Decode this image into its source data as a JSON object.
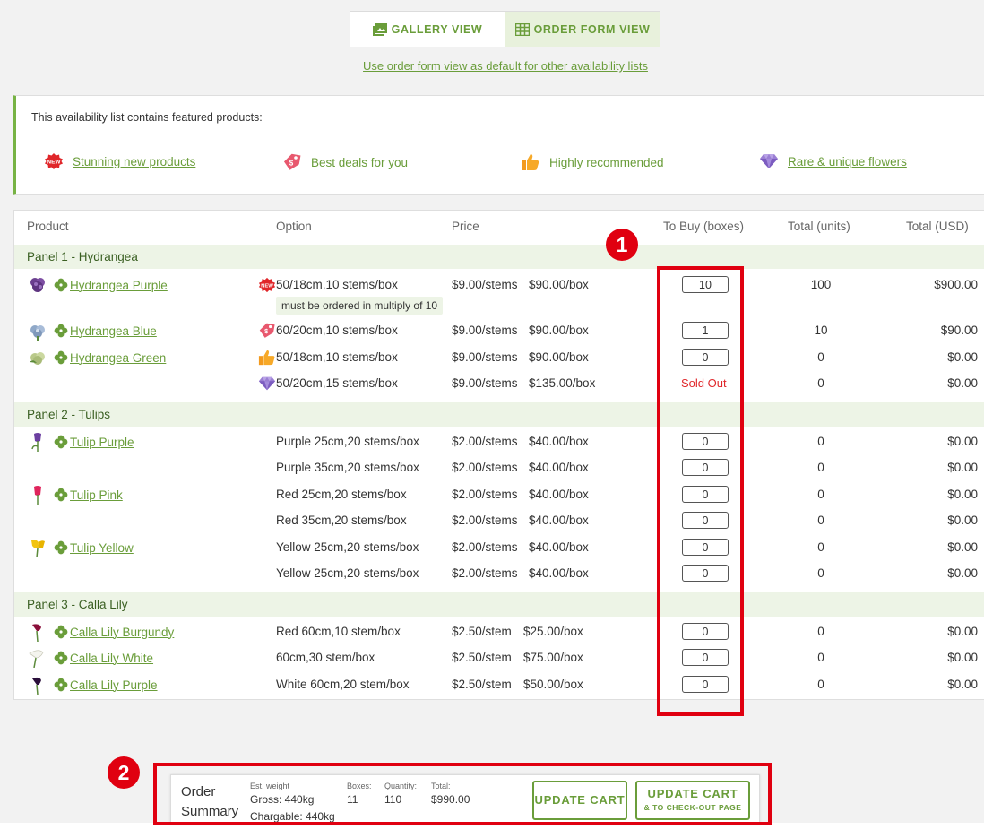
{
  "view_toggle": {
    "gallery_label": "GALLERY VIEW",
    "order_form_label": "ORDER FORM VIEW",
    "active": "order_form"
  },
  "default_link": "Use order form view as default for other availability lists",
  "featured": {
    "intro": "This availability list contains featured products:",
    "items": [
      {
        "icon": "new-badge-icon",
        "label": "Stunning new products"
      },
      {
        "icon": "price-tag-icon",
        "label": "Best deals for you"
      },
      {
        "icon": "thumbs-up-icon",
        "label": "Highly recommended"
      },
      {
        "icon": "diamond-icon",
        "label": "Rare & unique flowers"
      }
    ]
  },
  "table": {
    "headers": {
      "product": "Product",
      "option": "Option",
      "price": "Price",
      "to_buy": "To Buy (boxes)",
      "total_units": "Total (units)",
      "total_usd": "Total (USD)"
    },
    "panels": [
      {
        "label": "Panel 1 - Hydrangea"
      },
      {
        "label": "Panel 2 - Tulips"
      },
      {
        "label": "Panel 3 - Calla Lily"
      }
    ],
    "rows": [
      {
        "product": "Hydrangea Purple",
        "thumb": "hydrangea-purple",
        "badge": "new-badge-icon",
        "option": "50/18cm,10 stems/box",
        "price": "$9.00/stems",
        "box_price": "$90.00/box",
        "qty": "10",
        "units": "100",
        "usd": "$900.00"
      },
      {
        "product": "Hydrangea Blue",
        "thumb": "hydrangea-blue",
        "badge": "price-tag-icon",
        "option": "60/20cm,10 stems/box",
        "price": "$9.00/stems",
        "box_price": "$90.00/box",
        "qty": "1",
        "units": "10",
        "usd": "$90.00"
      },
      {
        "product": "Hydrangea Green",
        "thumb": "hydrangea-green",
        "badge": "thumbs-up-icon",
        "option": "50/18cm,10 stems/box",
        "price": "$9.00/stems",
        "box_price": "$90.00/box",
        "qty": "0",
        "units": "0",
        "usd": "$0.00"
      },
      {
        "product": "",
        "thumb": "",
        "badge": "diamond-icon",
        "option": "50/20cm,15 stems/box",
        "price": "$9.00/stems",
        "box_price": "$135.00/box",
        "status": "Sold Out",
        "units": "0",
        "usd": "$0.00"
      },
      {
        "product": "Tulip Purple",
        "thumb": "tulip-purple",
        "option": "Purple 25cm,20 stems/box",
        "price": "$2.00/stems",
        "box_price": "$40.00/box",
        "qty": "0",
        "units": "0",
        "usd": "$0.00"
      },
      {
        "product": "",
        "option": "Purple 35cm,20 stems/box",
        "price": "$2.00/stems",
        "box_price": "$40.00/box",
        "qty": "0",
        "units": "0",
        "usd": "$0.00"
      },
      {
        "product": "Tulip Pink",
        "thumb": "tulip-pink",
        "option": "Red 25cm,20 stems/box",
        "price": "$2.00/stems",
        "box_price": "$40.00/box",
        "qty": "0",
        "units": "0",
        "usd": "$0.00"
      },
      {
        "product": "",
        "option": "Red 35cm,20 stems/box",
        "price": "$2.00/stems",
        "box_price": "$40.00/box",
        "qty": "0",
        "units": "0",
        "usd": "$0.00"
      },
      {
        "product": "Tulip Yellow",
        "thumb": "tulip-yellow",
        "option": "Yellow 25cm,20 stems/box",
        "price": "$2.00/stems",
        "box_price": "$40.00/box",
        "qty": "0",
        "units": "0",
        "usd": "$0.00"
      },
      {
        "product": "",
        "option": "Yellow 25cm,20 stems/box",
        "price": "$2.00/stems",
        "box_price": "$40.00/box",
        "qty": "0",
        "units": "0",
        "usd": "$0.00"
      },
      {
        "product": "Calla Lily Burgundy",
        "thumb": "calla-burgundy",
        "option": "Red 60cm,10 stem/box",
        "price": "$2.50/stem",
        "box_price": "$25.00/box",
        "qty": "0",
        "units": "0",
        "usd": "$0.00"
      },
      {
        "product": "Calla Lily White",
        "thumb": "calla-white",
        "option": "60cm,30 stem/box",
        "price": "$2.50/stem",
        "box_price": "$75.00/box",
        "qty": "0",
        "units": "0",
        "usd": "$0.00"
      },
      {
        "product": "Calla Lily Purple",
        "thumb": "calla-purple",
        "option": "White 60cm,20 stem/box",
        "price": "$2.50/stem",
        "box_price": "$50.00/box",
        "qty": "0",
        "units": "0",
        "usd": "$0.00"
      }
    ],
    "tooltip": "must be ordered in multiply of 10"
  },
  "annotations": {
    "marker_1": "1",
    "marker_2": "2",
    "color": "#e00010"
  },
  "order_summary": {
    "title_line1": "Order",
    "title_line2": "Summary",
    "est_weight_label": "Est. weight",
    "gross": "Gross: 440kg",
    "chargable": "Chargable: 440kg",
    "boxes_label": "Boxes:",
    "boxes": "11",
    "quantity_label": "Quantity:",
    "quantity": "110",
    "total_label": "Total:",
    "total": "$990.00",
    "update_cart": "UPDATE CART",
    "update_checkout_line1": "UPDATE CART",
    "update_checkout_line2": "& TO CHECK-OUT PAGE"
  },
  "colors": {
    "accent": "#6a9d3a",
    "panel_bg": "#edf4e6",
    "sold_out": "#e0262a"
  }
}
